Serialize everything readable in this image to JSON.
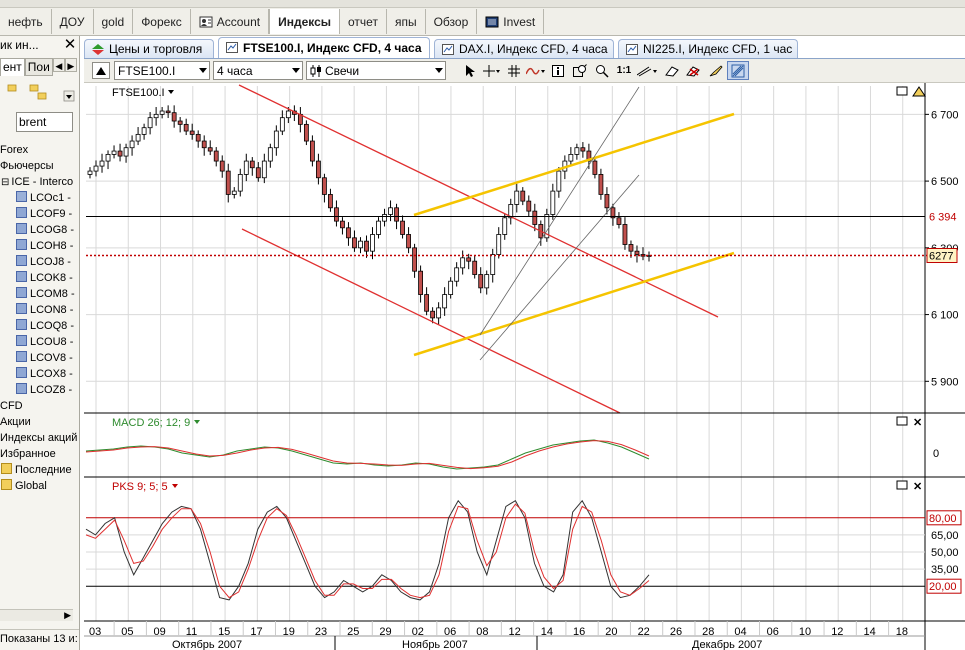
{
  "top_tabs": [
    {
      "label": "нефть",
      "icon": "none"
    },
    {
      "label": "ДОУ",
      "icon": "none"
    },
    {
      "label": "gold",
      "icon": "none"
    },
    {
      "label": "Форекс",
      "icon": "none"
    },
    {
      "label": "Account",
      "icon": "account-icon"
    },
    {
      "label": "Индексы",
      "icon": "none",
      "active": true
    },
    {
      "label": "отчет",
      "icon": "none"
    },
    {
      "label": "япы",
      "icon": "none"
    },
    {
      "label": "Обзор",
      "icon": "none"
    },
    {
      "label": "Invest",
      "icon": "invest-icon"
    }
  ],
  "left_panel": {
    "title": "ик ин...",
    "tab_selected": "ент",
    "tab_other": "Пои",
    "search_value": "brent",
    "tree": [
      {
        "label": "Forex",
        "indent": 0,
        "icon": "none"
      },
      {
        "label": "Фьючерсы",
        "indent": 0,
        "icon": "none"
      },
      {
        "label": "ICE - Interco",
        "indent": 1,
        "icon": "minus"
      },
      {
        "label": "LCOc1 -",
        "indent": 2,
        "icon": "s",
        "selected": true
      },
      {
        "label": "LCOF9 -",
        "indent": 2,
        "icon": "s"
      },
      {
        "label": "LCOG8 -",
        "indent": 2,
        "icon": "s"
      },
      {
        "label": "LCOH8 -",
        "indent": 2,
        "icon": "s"
      },
      {
        "label": "LCOJ8 -",
        "indent": 2,
        "icon": "s"
      },
      {
        "label": "LCOK8 -",
        "indent": 2,
        "icon": "s"
      },
      {
        "label": "LCOM8 -",
        "indent": 2,
        "icon": "s"
      },
      {
        "label": "LCON8 -",
        "indent": 2,
        "icon": "s"
      },
      {
        "label": "LCOQ8 -",
        "indent": 2,
        "icon": "s"
      },
      {
        "label": "LCOU8 -",
        "indent": 2,
        "icon": "s"
      },
      {
        "label": "LCOV8 -",
        "indent": 2,
        "icon": "s"
      },
      {
        "label": "LCOX8 -",
        "indent": 2,
        "icon": "s"
      },
      {
        "label": "LCOZ8 -",
        "indent": 2,
        "icon": "s"
      },
      {
        "label": "CFD",
        "indent": 0,
        "icon": "none"
      },
      {
        "label": "Акции",
        "indent": 0,
        "icon": "none"
      },
      {
        "label": "Индексы акций",
        "indent": 0,
        "icon": "none"
      },
      {
        "label": "Избранное",
        "indent": 0,
        "icon": "none"
      },
      {
        "label": "Последние",
        "indent": 0,
        "icon": "folder"
      },
      {
        "label": "Global",
        "indent": 0,
        "icon": "folder"
      }
    ],
    "status": "Показаны 13 и:"
  },
  "chart_tabs": [
    {
      "label": "Цены и торговля",
      "icon": "prices-icon"
    },
    {
      "label": "FTSE100.I, Индекс CFD, 4 часа",
      "icon": "chart-tab-icon",
      "active": true
    },
    {
      "label": "DAX.I, Индекс CFD, 4 часа",
      "icon": "chart-tab-icon"
    },
    {
      "label": "NI225.I, Индекс CFD, 1 час",
      "icon": "chart-tab-icon"
    }
  ],
  "toolbar": {
    "symbol": "FTSE100.I",
    "timeframe": "4 часа",
    "chart_type": "Свечи",
    "zoom_label": "1:1"
  },
  "colors": {
    "candle_bull": "#ffffff",
    "candle_bear": "#c0504d",
    "red_channel": "#e03030",
    "yellow_channel": "#f5c400",
    "macd_main": "#2e8b2e",
    "macd_signal": "#e03030",
    "stoch_k": "#333333",
    "stoch_d": "#e03030",
    "level_box": "#c00000"
  },
  "chart_data": [
    {
      "type": "candlestick",
      "title": "FTSE100.I",
      "y_ticks": [
        "6 700",
        "6 500",
        "6 300",
        "6 100",
        "5 900"
      ],
      "ylim": [
        5820,
        6770
      ],
      "horizontal_lines": [
        {
          "value": 6394,
          "label": "6 394",
          "style": "solid"
        },
        {
          "value": 6277,
          "label": "6277",
          "style": "dotted-current"
        }
      ],
      "close_series": [
        6530,
        6545,
        6560,
        6580,
        6590,
        6575,
        6600,
        6620,
        6640,
        6660,
        6690,
        6700,
        6710,
        6705,
        6680,
        6670,
        6650,
        6640,
        6620,
        6600,
        6590,
        6560,
        6530,
        6460,
        6470,
        6520,
        6560,
        6540,
        6510,
        6560,
        6600,
        6650,
        6690,
        6710,
        6700,
        6670,
        6620,
        6560,
        6510,
        6460,
        6420,
        6380,
        6360,
        6330,
        6300,
        6320,
        6290,
        6340,
        6380,
        6400,
        6420,
        6380,
        6340,
        6300,
        6230,
        6160,
        6110,
        6090,
        6120,
        6160,
        6200,
        6240,
        6270,
        6260,
        6220,
        6180,
        6220,
        6280,
        6340,
        6390,
        6430,
        6470,
        6440,
        6410,
        6370,
        6330,
        6400,
        6470,
        6530,
        6560,
        6580,
        6600,
        6590,
        6560,
        6520,
        6460,
        6420,
        6390,
        6370,
        6310,
        6290,
        6280,
        6275,
        6277
      ],
      "x_ticks": [
        "03",
        "05",
        "09",
        "11",
        "15",
        "17",
        "19",
        "23",
        "25",
        "29",
        "02",
        "06",
        "08",
        "12",
        "14",
        "16",
        "20",
        "22",
        "26",
        "28",
        "04",
        "06",
        "10",
        "12",
        "14",
        "18"
      ],
      "x_months": [
        "Октябрь 2007",
        "Ноябрь 2007",
        "Декабрь 2007"
      ]
    },
    {
      "type": "line",
      "title": "MACD 26; 12; 9",
      "y_ticks": [
        "0"
      ],
      "ylim": [
        -1,
        1
      ],
      "series": [
        {
          "name": "MACD",
          "values": [
            0.1,
            0.15,
            0.2,
            0.3,
            0.35,
            0.3,
            0.2,
            0.0,
            -0.1,
            -0.2,
            -0.1,
            0.1,
            0.2,
            0.3,
            0.25,
            0.1,
            -0.1,
            -0.3,
            -0.5,
            -0.55,
            -0.5,
            -0.6,
            -0.65,
            -0.6,
            -0.5,
            -0.55,
            -0.7,
            -0.8,
            -0.75,
            -0.7,
            -0.6,
            -0.3,
            0.0,
            0.2,
            0.4,
            0.5,
            0.6,
            0.65,
            0.5,
            0.3,
            0.0,
            -0.3
          ]
        },
        {
          "name": "Signal",
          "values": [
            0.05,
            0.1,
            0.15,
            0.25,
            0.3,
            0.32,
            0.25,
            0.1,
            -0.05,
            -0.15,
            -0.12,
            0.0,
            0.15,
            0.25,
            0.28,
            0.18,
            0.0,
            -0.2,
            -0.4,
            -0.5,
            -0.52,
            -0.55,
            -0.6,
            -0.62,
            -0.55,
            -0.52,
            -0.62,
            -0.72,
            -0.78,
            -0.74,
            -0.66,
            -0.45,
            -0.15,
            0.1,
            0.3,
            0.45,
            0.55,
            0.62,
            0.58,
            0.42,
            0.15,
            -0.15
          ]
        }
      ]
    },
    {
      "type": "line",
      "title": "PKS 9; 5; 5",
      "y_ticks": [
        "80,00",
        "65,00",
        "50,00",
        "35,00",
        "20,00"
      ],
      "ylim": [
        0,
        100
      ],
      "levels": [
        80,
        20
      ],
      "series": [
        {
          "name": "%K",
          "values": [
            70,
            65,
            75,
            80,
            50,
            30,
            45,
            60,
            75,
            85,
            90,
            88,
            70,
            40,
            10,
            8,
            20,
            40,
            70,
            85,
            90,
            80,
            60,
            40,
            20,
            10,
            15,
            25,
            20,
            15,
            20,
            30,
            25,
            15,
            10,
            8,
            15,
            40,
            80,
            95,
            85,
            50,
            30,
            60,
            90,
            95,
            80,
            40,
            20,
            15,
            30,
            85,
            95,
            80,
            50,
            20,
            10,
            12,
            20,
            30
          ]
        },
        {
          "name": "%D",
          "values": [
            65,
            62,
            70,
            78,
            60,
            40,
            42,
            55,
            70,
            80,
            88,
            88,
            75,
            50,
            20,
            10,
            15,
            35,
            60,
            80,
            88,
            82,
            65,
            45,
            25,
            12,
            12,
            22,
            22,
            18,
            18,
            26,
            26,
            18,
            12,
            10,
            12,
            30,
            68,
            90,
            88,
            60,
            38,
            50,
            80,
            92,
            84,
            50,
            28,
            18,
            25,
            70,
            90,
            85,
            60,
            30,
            15,
            12,
            18,
            25
          ]
        }
      ]
    }
  ]
}
